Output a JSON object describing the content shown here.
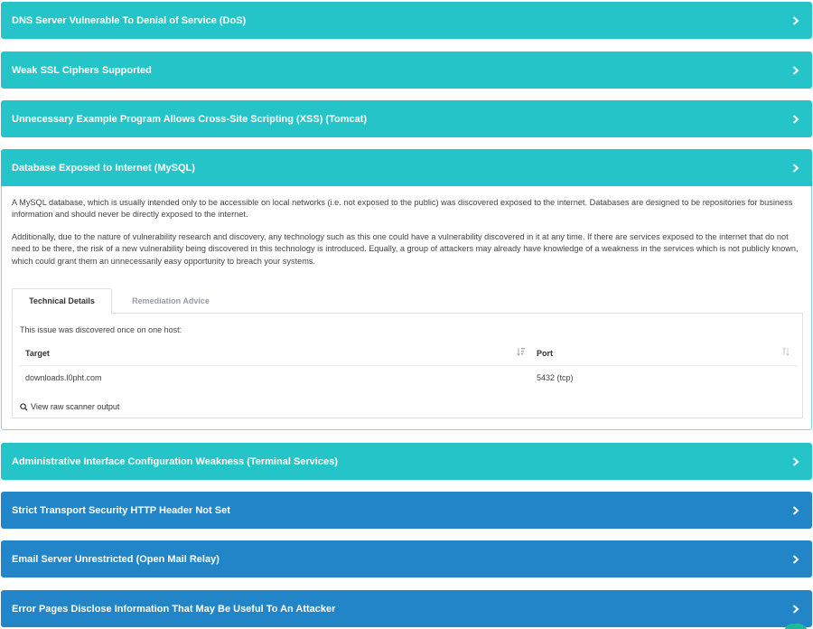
{
  "findings": [
    {
      "title": "DNS Server Vulnerable To Denial of Service (DoS)",
      "color": "#25c4c8"
    },
    {
      "title": "Weak SSL Ciphers Supported",
      "color": "#25c4c8"
    },
    {
      "title": "Unnecessary Example Program Allows Cross-Site Scripting (XSS) (Tomcat)",
      "color": "#25c4c8"
    },
    {
      "title": "Database Exposed to Internet (MySQL)",
      "color": "#25c4c8",
      "expanded": true
    },
    {
      "title": "Administrative Interface Configuration Weakness (Terminal Services)",
      "color": "#25c4c8"
    },
    {
      "title": "Strict Transport Security HTTP Header Not Set",
      "color": "#2185c8"
    },
    {
      "title": "Email Server Unrestricted (Open Mail Relay)",
      "color": "#2185c8"
    },
    {
      "title": "Error Pages Disclose Information That May Be Useful To An Attacker",
      "color": "#2185c8"
    }
  ],
  "detail": {
    "paragraph1": "A MySQL database, which is usually intended only to be accessible on local networks (i.e. not exposed to the public) was discovered exposed to the internet. Databases are designed to be repositories for business information and should never be directly exposed to the internet.",
    "paragraph2": "Additionally, due to the nature of vulnerability research and discovery, any technology such as this one could have a vulnerability discovered in it at any time. If there are services exposed to the internet that do not need to be there, the risk of a new vulnerability being discovered in this technology is introduced. Equally, a group of attackers may already have knowledge of a weakness in the services which is not publicly known, which could grant them an unnecessarily easy opportunity to breach your systems.",
    "tabs": [
      "Technical Details",
      "Remediation Advice"
    ],
    "found_text": "This issue was discovered once on one host:",
    "table": {
      "headers": [
        "Target",
        "Port"
      ],
      "rows": [
        [
          "downloads.l0pht.com",
          "5432 (tcp)"
        ]
      ]
    },
    "raw_link": "View raw scanner output"
  },
  "colors": {
    "teal": "#25c4c8",
    "blue": "#2185c8"
  },
  "icons": {
    "chevron": "chevron-right-icon",
    "search": "search-icon",
    "sort": "sort-icon"
  }
}
